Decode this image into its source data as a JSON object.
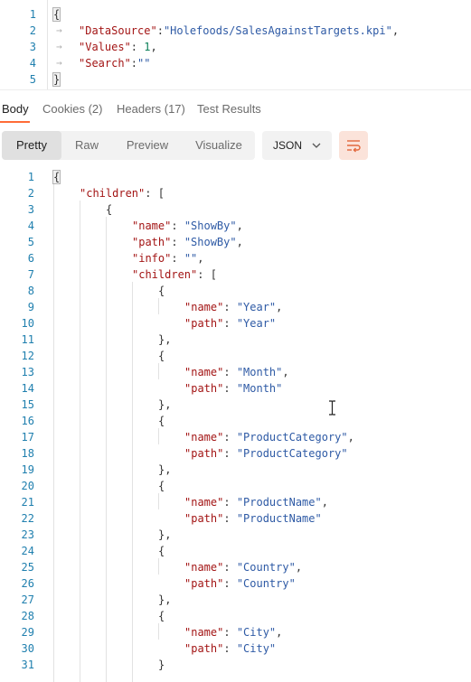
{
  "request_editor": {
    "lines": [
      {
        "no": "1",
        "parts": [
          {
            "t": "{",
            "c": "brace"
          }
        ]
      },
      {
        "no": "2",
        "parts": [
          {
            "t": "\"DataSource\"",
            "c": "k"
          },
          {
            "t": ":",
            "c": "p"
          },
          {
            "t": "\"Holefoods/SalesAgainstTargets.kpi\"",
            "c": "s"
          },
          {
            "t": ",",
            "c": "p"
          }
        ]
      },
      {
        "no": "3",
        "parts": [
          {
            "t": "\"Values\"",
            "c": "k"
          },
          {
            "t": ": ",
            "c": "p"
          },
          {
            "t": "1",
            "c": "n"
          },
          {
            "t": ",",
            "c": "p"
          }
        ]
      },
      {
        "no": "4",
        "parts": [
          {
            "t": "\"Search\"",
            "c": "k"
          },
          {
            "t": ":",
            "c": "p"
          },
          {
            "t": "\"\"",
            "c": "s"
          }
        ]
      },
      {
        "no": "5",
        "parts": [
          {
            "t": "}",
            "c": "brace"
          }
        ]
      }
    ]
  },
  "response_tabs": [
    {
      "label": "Body",
      "active": true
    },
    {
      "label": "Cookies (2)",
      "active": false
    },
    {
      "label": "Headers (17)",
      "active": false
    },
    {
      "label": "Test Results",
      "active": false
    }
  ],
  "view_modes": [
    {
      "label": "Pretty",
      "active": true
    },
    {
      "label": "Raw",
      "active": false
    },
    {
      "label": "Preview",
      "active": false
    },
    {
      "label": "Visualize",
      "active": false
    }
  ],
  "format_select": {
    "value": "JSON",
    "icon": "chevron-down-icon"
  },
  "wrap_button": {
    "icon": "wrap-lines-icon"
  },
  "response_lines": [
    {
      "no": "1",
      "indent": 0,
      "parts": [
        {
          "t": "{",
          "c": "brace"
        }
      ]
    },
    {
      "no": "2",
      "indent": 1,
      "parts": [
        {
          "t": "\"children\"",
          "c": "k"
        },
        {
          "t": ": [",
          "c": "p"
        }
      ]
    },
    {
      "no": "3",
      "indent": 2,
      "parts": [
        {
          "t": "{",
          "c": "p"
        }
      ]
    },
    {
      "no": "4",
      "indent": 3,
      "parts": [
        {
          "t": "\"name\"",
          "c": "k"
        },
        {
          "t": ": ",
          "c": "p"
        },
        {
          "t": "\"ShowBy\"",
          "c": "s"
        },
        {
          "t": ",",
          "c": "p"
        }
      ]
    },
    {
      "no": "5",
      "indent": 3,
      "parts": [
        {
          "t": "\"path\"",
          "c": "k"
        },
        {
          "t": ": ",
          "c": "p"
        },
        {
          "t": "\"ShowBy\"",
          "c": "s"
        },
        {
          "t": ",",
          "c": "p"
        }
      ]
    },
    {
      "no": "6",
      "indent": 3,
      "parts": [
        {
          "t": "\"info\"",
          "c": "k"
        },
        {
          "t": ": ",
          "c": "p"
        },
        {
          "t": "\"\"",
          "c": "s"
        },
        {
          "t": ",",
          "c": "p"
        }
      ]
    },
    {
      "no": "7",
      "indent": 3,
      "parts": [
        {
          "t": "\"children\"",
          "c": "k"
        },
        {
          "t": ": [",
          "c": "p"
        }
      ]
    },
    {
      "no": "8",
      "indent": 4,
      "parts": [
        {
          "t": "{",
          "c": "p"
        }
      ]
    },
    {
      "no": "9",
      "indent": 5,
      "parts": [
        {
          "t": "\"name\"",
          "c": "k"
        },
        {
          "t": ": ",
          "c": "p"
        },
        {
          "t": "\"Year\"",
          "c": "s"
        },
        {
          "t": ",",
          "c": "p"
        }
      ]
    },
    {
      "no": "10",
      "indent": 5,
      "parts": [
        {
          "t": "\"path\"",
          "c": "k"
        },
        {
          "t": ": ",
          "c": "p"
        },
        {
          "t": "\"Year\"",
          "c": "s"
        }
      ]
    },
    {
      "no": "11",
      "indent": 4,
      "parts": [
        {
          "t": "},",
          "c": "p"
        }
      ]
    },
    {
      "no": "12",
      "indent": 4,
      "parts": [
        {
          "t": "{",
          "c": "p"
        }
      ]
    },
    {
      "no": "13",
      "indent": 5,
      "parts": [
        {
          "t": "\"name\"",
          "c": "k"
        },
        {
          "t": ": ",
          "c": "p"
        },
        {
          "t": "\"Month\"",
          "c": "s"
        },
        {
          "t": ",",
          "c": "p"
        }
      ]
    },
    {
      "no": "14",
      "indent": 5,
      "parts": [
        {
          "t": "\"path\"",
          "c": "k"
        },
        {
          "t": ": ",
          "c": "p"
        },
        {
          "t": "\"Month\"",
          "c": "s"
        }
      ]
    },
    {
      "no": "15",
      "indent": 4,
      "parts": [
        {
          "t": "},",
          "c": "p"
        }
      ]
    },
    {
      "no": "16",
      "indent": 4,
      "parts": [
        {
          "t": "{",
          "c": "p"
        }
      ]
    },
    {
      "no": "17",
      "indent": 5,
      "parts": [
        {
          "t": "\"name\"",
          "c": "k"
        },
        {
          "t": ": ",
          "c": "p"
        },
        {
          "t": "\"ProductCategory\"",
          "c": "s"
        },
        {
          "t": ",",
          "c": "p"
        }
      ]
    },
    {
      "no": "18",
      "indent": 5,
      "parts": [
        {
          "t": "\"path\"",
          "c": "k"
        },
        {
          "t": ": ",
          "c": "p"
        },
        {
          "t": "\"ProductCategory\"",
          "c": "s"
        }
      ]
    },
    {
      "no": "19",
      "indent": 4,
      "parts": [
        {
          "t": "},",
          "c": "p"
        }
      ]
    },
    {
      "no": "20",
      "indent": 4,
      "parts": [
        {
          "t": "{",
          "c": "p"
        }
      ]
    },
    {
      "no": "21",
      "indent": 5,
      "parts": [
        {
          "t": "\"name\"",
          "c": "k"
        },
        {
          "t": ": ",
          "c": "p"
        },
        {
          "t": "\"ProductName\"",
          "c": "s"
        },
        {
          "t": ",",
          "c": "p"
        }
      ]
    },
    {
      "no": "22",
      "indent": 5,
      "parts": [
        {
          "t": "\"path\"",
          "c": "k"
        },
        {
          "t": ": ",
          "c": "p"
        },
        {
          "t": "\"ProductName\"",
          "c": "s"
        }
      ]
    },
    {
      "no": "23",
      "indent": 4,
      "parts": [
        {
          "t": "},",
          "c": "p"
        }
      ]
    },
    {
      "no": "24",
      "indent": 4,
      "parts": [
        {
          "t": "{",
          "c": "p"
        }
      ]
    },
    {
      "no": "25",
      "indent": 5,
      "parts": [
        {
          "t": "\"name\"",
          "c": "k"
        },
        {
          "t": ": ",
          "c": "p"
        },
        {
          "t": "\"Country\"",
          "c": "s"
        },
        {
          "t": ",",
          "c": "p"
        }
      ]
    },
    {
      "no": "26",
      "indent": 5,
      "parts": [
        {
          "t": "\"path\"",
          "c": "k"
        },
        {
          "t": ": ",
          "c": "p"
        },
        {
          "t": "\"Country\"",
          "c": "s"
        }
      ]
    },
    {
      "no": "27",
      "indent": 4,
      "parts": [
        {
          "t": "},",
          "c": "p"
        }
      ]
    },
    {
      "no": "28",
      "indent": 4,
      "parts": [
        {
          "t": "{",
          "c": "p"
        }
      ]
    },
    {
      "no": "29",
      "indent": 5,
      "parts": [
        {
          "t": "\"name\"",
          "c": "k"
        },
        {
          "t": ": ",
          "c": "p"
        },
        {
          "t": "\"City\"",
          "c": "s"
        },
        {
          "t": ",",
          "c": "p"
        }
      ]
    },
    {
      "no": "30",
      "indent": 5,
      "parts": [
        {
          "t": "\"path\"",
          "c": "k"
        },
        {
          "t": ": ",
          "c": "p"
        },
        {
          "t": "\"City\"",
          "c": "s"
        }
      ]
    },
    {
      "no": "31",
      "indent": 4,
      "parts": [
        {
          "t": "}",
          "c": "p"
        }
      ]
    }
  ],
  "colors": {
    "accent": "#ff6c37",
    "key": "#a31515",
    "string": "#2e5aa5",
    "number": "#0b7f58",
    "line_number": "#1f7fae"
  }
}
